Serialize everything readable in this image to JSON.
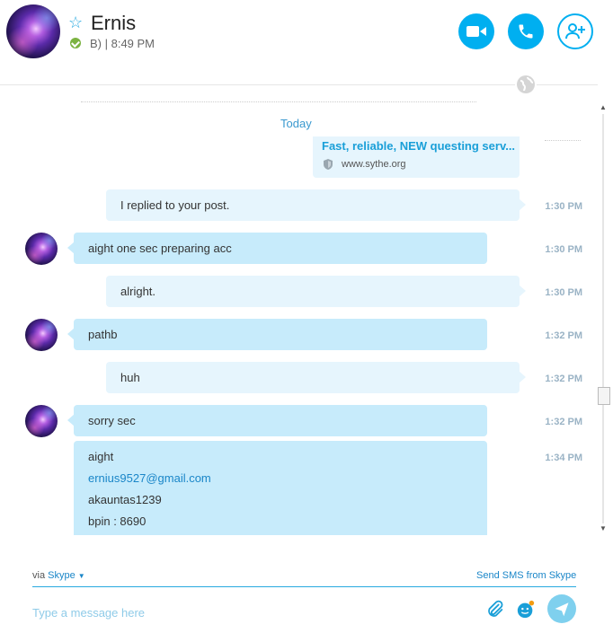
{
  "header": {
    "contact_name": "Ernis",
    "mood_and_time": "B) | 8:49 PM",
    "star_icon": "star-outline-icon",
    "status": "online",
    "actions": [
      {
        "name": "video-call",
        "icon": "video-camera-icon"
      },
      {
        "name": "audio-call",
        "icon": "phone-icon"
      },
      {
        "name": "add-people",
        "icon": "add-person-icon"
      }
    ]
  },
  "conversation": {
    "day_label": "Today",
    "link_preview": {
      "title": "Fast, reliable, NEW questing serv...",
      "url": "www.sythe.org"
    },
    "messages": [
      {
        "direction": "out",
        "text": "I replied to your post.",
        "time": "1:30 PM"
      },
      {
        "direction": "in",
        "text": "aight one sec preparing acc",
        "time": "1:30 PM"
      },
      {
        "direction": "out",
        "text": "alright.",
        "time": "1:30 PM"
      },
      {
        "direction": "in",
        "text": "pathb",
        "time": "1:32 PM"
      },
      {
        "direction": "out",
        "text": "huh",
        "time": "1:32 PM"
      },
      {
        "direction": "in",
        "text": "sorry sec",
        "time": "1:32 PM"
      },
      {
        "direction": "in",
        "lines": [
          "aight",
          "ernius9527@gmail.com",
          "akauntas1239",
          "bpin : 8690"
        ],
        "time": "1:34 PM"
      }
    ]
  },
  "footer": {
    "via_label": "via",
    "via_service": "Skype",
    "sms_link": "Send SMS from Skype",
    "input_placeholder": "Type a message here",
    "icons": [
      "paperclip-icon",
      "emoticon-icon",
      "send-icon"
    ]
  },
  "colors": {
    "accent": "#00aff0",
    "incoming_bubble": "#c7ebfb",
    "outgoing_bubble": "#e6f5fd",
    "timestamp": "#9ab3c5"
  }
}
